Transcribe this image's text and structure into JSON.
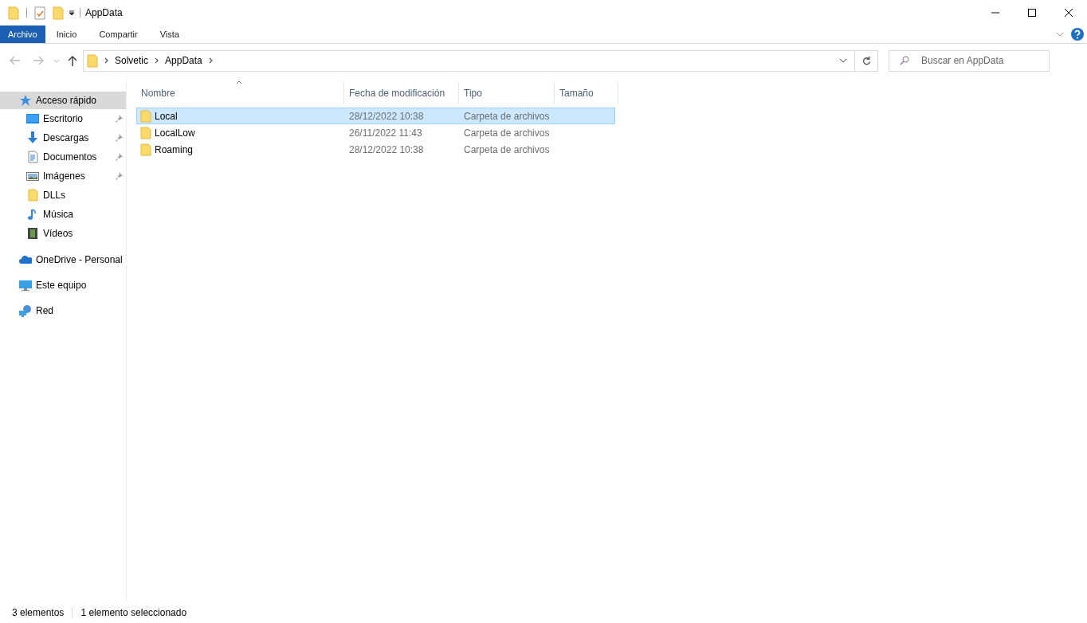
{
  "window": {
    "title": "AppData"
  },
  "ribbon": {
    "tabs": [
      {
        "label": "Archivo",
        "selected": true
      },
      {
        "label": "Inicio",
        "selected": false
      },
      {
        "label": "Compartir",
        "selected": false
      },
      {
        "label": "Vista",
        "selected": false
      }
    ]
  },
  "address_bar": {
    "path": [
      "Solvetic",
      "AppData"
    ]
  },
  "search": {
    "placeholder": "Buscar en AppData"
  },
  "sidebar": {
    "items": [
      {
        "label": "Acceso rápido",
        "kind": "star",
        "selected": true,
        "children": [
          {
            "label": "Escritorio",
            "kind": "desktop",
            "pinned": true
          },
          {
            "label": "Descargas",
            "kind": "download",
            "pinned": true
          },
          {
            "label": "Documentos",
            "kind": "document",
            "pinned": true
          },
          {
            "label": "Imágenes",
            "kind": "images",
            "pinned": true
          },
          {
            "label": "DLLs",
            "kind": "folder",
            "pinned": false
          },
          {
            "label": "Música",
            "kind": "music",
            "pinned": false
          },
          {
            "label": "Vídeos",
            "kind": "video",
            "pinned": false
          }
        ]
      },
      {
        "label": "OneDrive - Personal",
        "kind": "cloud",
        "selected": false
      },
      {
        "label": "Este equipo",
        "kind": "computer",
        "selected": false
      },
      {
        "label": "Red",
        "kind": "network",
        "selected": false
      }
    ]
  },
  "table": {
    "columns": [
      "Nombre",
      "Fecha de modificación",
      "Tipo",
      "Tamaño"
    ],
    "rows": [
      {
        "name": "Local",
        "date": "28/12/2022 10:38",
        "type": "Carpeta de archivos",
        "selected": true
      },
      {
        "name": "LocalLow",
        "date": "26/11/2022 11:43",
        "type": "Carpeta de archivos",
        "selected": false
      },
      {
        "name": "Roaming",
        "date": "28/12/2022 10:38",
        "type": "Carpeta de archivos",
        "selected": false
      }
    ]
  },
  "status_bar": {
    "count": "3 elementos",
    "selection": "1 elemento seleccionado"
  }
}
